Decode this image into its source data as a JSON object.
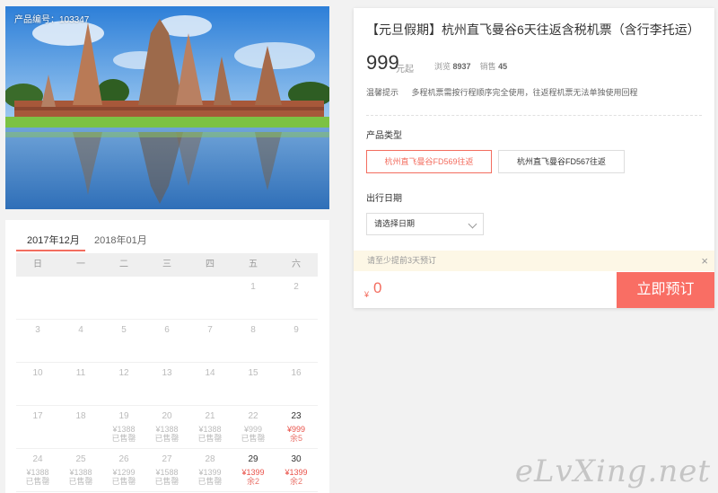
{
  "product": {
    "number_label": "产品编号：103347"
  },
  "calendar": {
    "tabs": [
      "2017年12月",
      "2018年01月"
    ],
    "weekdays": [
      "日",
      "一",
      "二",
      "三",
      "四",
      "五",
      "六"
    ],
    "rows": [
      [
        {
          "d": ""
        },
        {
          "d": ""
        },
        {
          "d": ""
        },
        {
          "d": ""
        },
        {
          "d": ""
        },
        {
          "d": "1"
        },
        {
          "d": "2"
        }
      ],
      [
        {
          "d": "3"
        },
        {
          "d": "4"
        },
        {
          "d": "5"
        },
        {
          "d": "6"
        },
        {
          "d": "7"
        },
        {
          "d": "8"
        },
        {
          "d": "9"
        }
      ],
      [
        {
          "d": "10"
        },
        {
          "d": "11"
        },
        {
          "d": "12"
        },
        {
          "d": "13"
        },
        {
          "d": "14"
        },
        {
          "d": "15"
        },
        {
          "d": "16"
        }
      ],
      [
        {
          "d": "17"
        },
        {
          "d": "18"
        },
        {
          "d": "19",
          "p": "¥1388",
          "s": "已售罄"
        },
        {
          "d": "20",
          "p": "¥1388",
          "s": "已售罄"
        },
        {
          "d": "21",
          "p": "¥1388",
          "s": "已售罄"
        },
        {
          "d": "22",
          "p": "¥999",
          "s": "已售罄"
        },
        {
          "d": "23",
          "p": "¥999",
          "s": "余5",
          "on": true
        }
      ],
      [
        {
          "d": "24",
          "p": "¥1388",
          "s": "已售罄"
        },
        {
          "d": "25",
          "p": "¥1388",
          "s": "已售罄"
        },
        {
          "d": "26",
          "p": "¥1299",
          "s": "已售罄"
        },
        {
          "d": "27",
          "p": "¥1588",
          "s": "已售罄"
        },
        {
          "d": "28",
          "p": "¥1399",
          "s": "已售罄"
        },
        {
          "d": "29",
          "p": "¥1399",
          "s": "余2",
          "on": true
        },
        {
          "d": "30",
          "p": "¥1399",
          "s": "余2",
          "on": true
        }
      ]
    ]
  },
  "panel": {
    "title": "【元旦假期】杭州直飞曼谷6天往返含税机票（含行李托运）",
    "price": "999",
    "price_unit": "元起",
    "views_label": "浏览",
    "views": "8937",
    "sales_label": "销售",
    "sales": "45",
    "tips_label": "温馨提示",
    "tips_text": "多程机票需按行程顺序完全使用，往返程机票无法单独使用回程",
    "product_type_label": "产品类型",
    "product_options": [
      "杭州直飞曼谷FD569往返",
      "杭州直飞曼谷FD567往返"
    ],
    "departure_label": "出行日期",
    "date_placeholder": "请选择日期",
    "notice": "请至少提前3天预订",
    "close_icon": "×",
    "currency": "¥",
    "total": "0",
    "book_label": "立即预订"
  },
  "watermark": "eLvXing.net",
  "colors": {
    "accent": "#f36d5f",
    "button": "#f96e64",
    "notice_bg": "#fdf7e6"
  }
}
